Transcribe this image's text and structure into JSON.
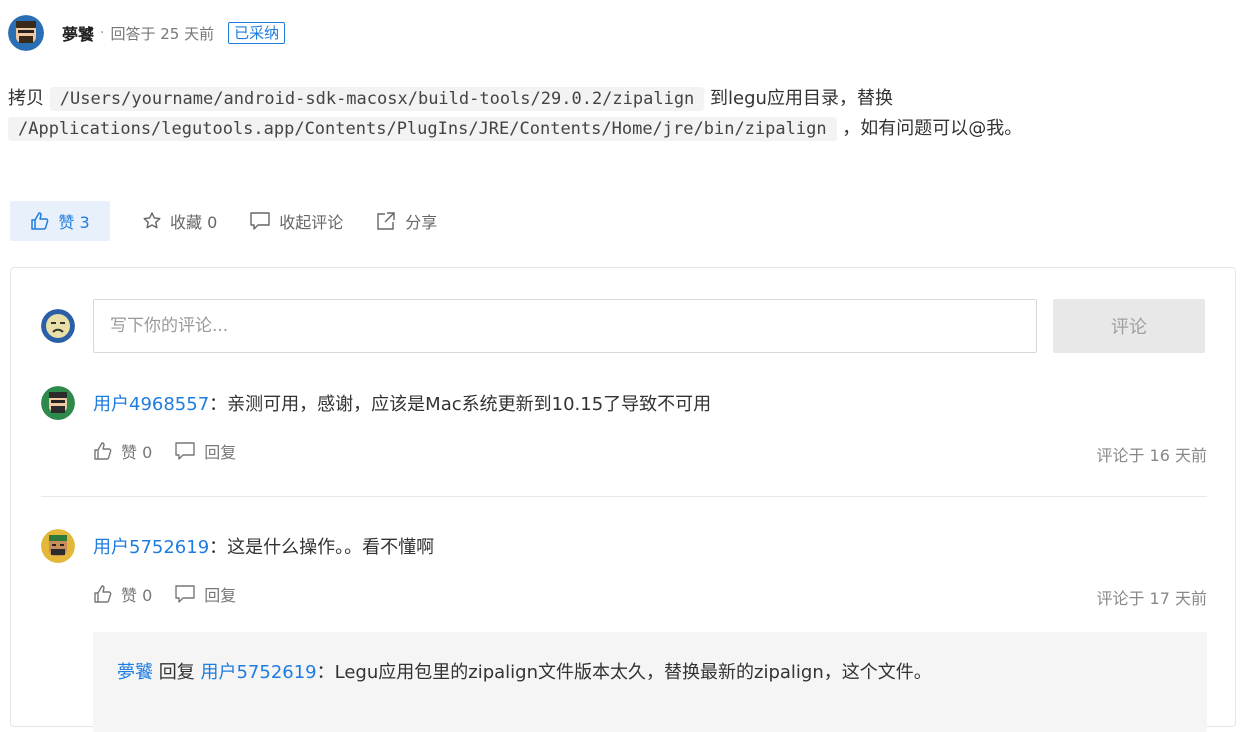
{
  "answer": {
    "author": "夢饕",
    "separator": "·",
    "meta": "回答于 25 天前",
    "badge": "已采纳",
    "text_part1": "拷贝",
    "code1": "/Users/yourname/android-sdk-macosx/build-tools/29.0.2/zipalign",
    "text_part2": "到legu应用目录，替换",
    "code2": "/Applications/legutools.app/Contents/PlugIns/JRE/Contents/Home/jre/bin/zipalign",
    "text_part3": "，如有问题可以@我。"
  },
  "actions": {
    "like_label": "赞 3",
    "favorite_label": "收藏 0",
    "collapse_label": "收起评论",
    "share_label": "分享"
  },
  "comment_form": {
    "placeholder": "写下你的评论...",
    "submit_label": "评论"
  },
  "comments": [
    {
      "user": "用户4968557",
      "colon": "：",
      "text": "亲测可用，感谢，应该是Mac系统更新到10.15了导致不可用",
      "like_label": "赞 0",
      "reply_label": "回复",
      "time": "评论于 16 天前"
    },
    {
      "user": "用户5752619",
      "colon": "：",
      "text": "这是什么操作。。看不懂啊",
      "like_label": "赞 0",
      "reply_label": "回复",
      "time": "评论于 17 天前"
    }
  ],
  "reply": {
    "from": "夢饕",
    "verb": "回复",
    "to": "用户5752619",
    "colon": "：",
    "text": "Legu应用包里的zipalign文件版本太久，替换最新的zipalign，这个文件。"
  },
  "colors": {
    "accent": "#1e7cdf",
    "like_bg": "#e8f1fb",
    "reply_bg": "#f5f5f5"
  }
}
